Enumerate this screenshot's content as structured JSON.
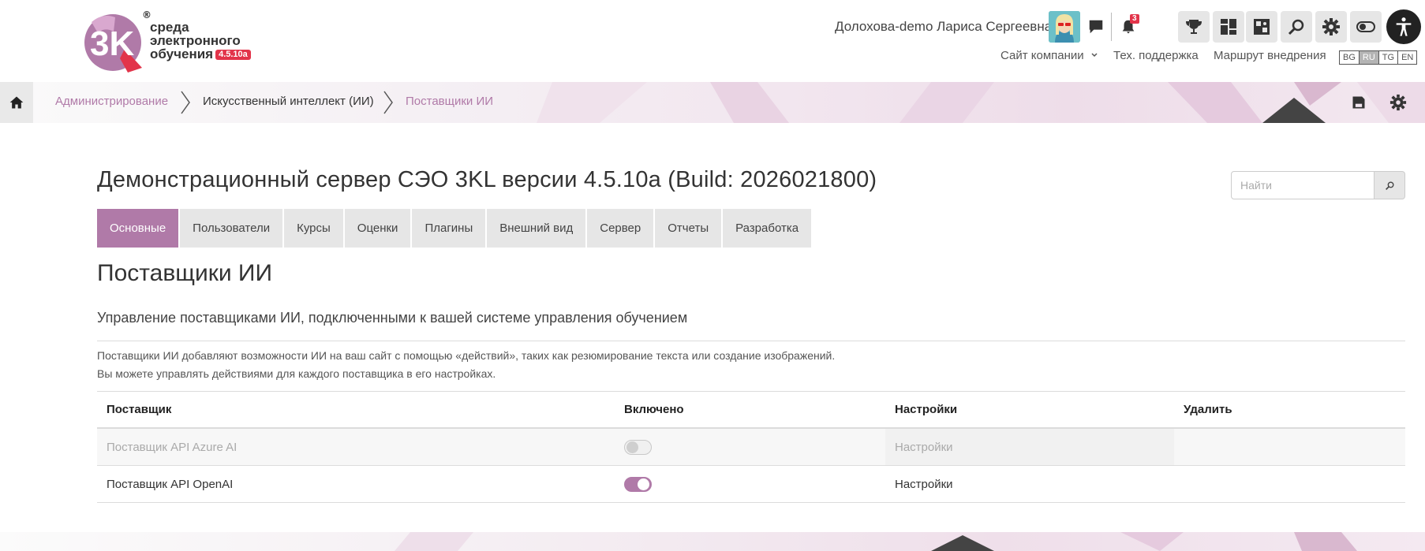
{
  "logo": {
    "line1": "среда",
    "line2": "электронного",
    "line3": "обучения",
    "version": "4.5.10a",
    "registered": "®",
    "mark_text": "3K"
  },
  "header": {
    "user_name": "Долохова-demo Лариса Сергеевна",
    "notifications_count": "3",
    "links": {
      "company_site": "Сайт компании",
      "support": "Тех. поддержка",
      "route": "Маршрут внедрения"
    },
    "languages": [
      "BG",
      "RU",
      "TG",
      "EN"
    ],
    "active_language": "RU"
  },
  "breadcrumb": {
    "items": [
      "Администрирование",
      "Искусственный интеллект (ИИ)",
      "Поставщики ИИ"
    ]
  },
  "page": {
    "title": "Демонстрационный сервер СЭО 3KL версии 4.5.10a (Build: 2026021800)",
    "search_placeholder": "Найти"
  },
  "tabs": [
    "Основные",
    "Пользователи",
    "Курсы",
    "Оценки",
    "Плагины",
    "Внешний вид",
    "Сервер",
    "Отчеты",
    "Разработка"
  ],
  "active_tab": "Основные",
  "section": {
    "title": "Поставщики ИИ",
    "subtitle": "Управление поставщиками ИИ, подключенными к вашей системе управления обучением",
    "desc_line1": "Поставщики ИИ добавляют возможности ИИ на ваш сайт с помощью «действий», таких как резюмирование текста или создание изображений.",
    "desc_line2": "Вы можете управлять действиями для каждого поставщика в его настройках."
  },
  "table": {
    "headers": {
      "provider": "Поставщик",
      "enabled": "Включено",
      "settings": "Настройки",
      "delete": "Удалить"
    },
    "rows": [
      {
        "provider": "Поставщик API Azure AI",
        "enabled": false,
        "settings": "Настройки"
      },
      {
        "provider": "Поставщик API OpenAI",
        "enabled": true,
        "settings": "Настройки"
      }
    ]
  },
  "colors": {
    "accent": "#b07aa8",
    "badge_red": "#e2344a",
    "tab_bg": "#e6e6e6"
  },
  "icons": {
    "header": [
      "chat-icon",
      "bell-icon"
    ],
    "tools": [
      "trophy-icon",
      "dashboard-icon",
      "puzzle-icon",
      "search-icon",
      "gear-icon",
      "toggle-icon",
      "accessibility-icon"
    ],
    "breadcrumb": [
      "home-icon",
      "save-icon",
      "gear-icon"
    ]
  }
}
